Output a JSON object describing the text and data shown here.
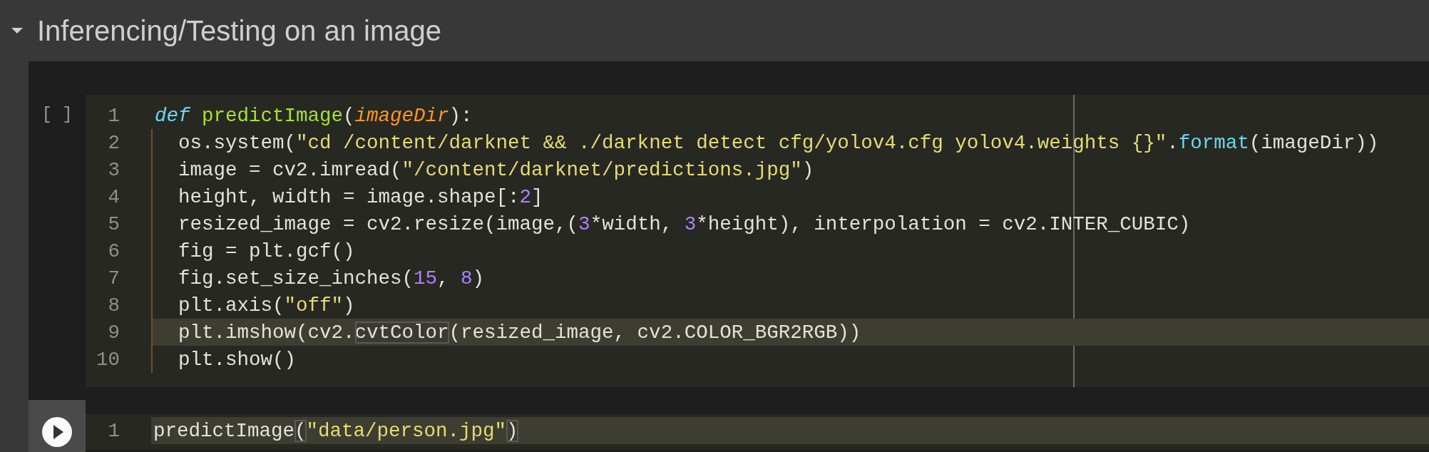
{
  "section": {
    "title": "Inferencing/Testing on an image",
    "expanded": true
  },
  "cells": [
    {
      "kind": "code",
      "execution_label": "[ ]",
      "lines": [
        {
          "number": "1",
          "active": false,
          "tokens": [
            {
              "kind": "keyword",
              "text": "def"
            },
            {
              "kind": "defname",
              "text": " predictImage"
            },
            {
              "kind": "plain",
              "text": "("
            },
            {
              "kind": "param",
              "text": "imageDir"
            },
            {
              "kind": "plain",
              "text": "):"
            }
          ]
        },
        {
          "number": "2",
          "active": false,
          "tokens": [
            {
              "kind": "plain",
              "text": "  os.system("
            },
            {
              "kind": "string",
              "text": "\"cd /content/darknet && ./darknet detect cfg/yolov4.cfg yolov4.weights {}\""
            },
            {
              "kind": "plain",
              "text": "."
            },
            {
              "kind": "builtin",
              "text": "format"
            },
            {
              "kind": "plain",
              "text": "(imageDir))"
            }
          ]
        },
        {
          "number": "3",
          "active": false,
          "tokens": [
            {
              "kind": "plain",
              "text": "  image = cv2.imread("
            },
            {
              "kind": "string",
              "text": "\"/content/darknet/predictions.jpg\""
            },
            {
              "kind": "plain",
              "text": ")"
            }
          ]
        },
        {
          "number": "4",
          "active": false,
          "tokens": [
            {
              "kind": "plain",
              "text": "  height, width = image.shape[:"
            },
            {
              "kind": "number",
              "text": "2"
            },
            {
              "kind": "plain",
              "text": "]"
            }
          ]
        },
        {
          "number": "5",
          "active": false,
          "tokens": [
            {
              "kind": "plain",
              "text": "  resized_image = cv2.resize(image,("
            },
            {
              "kind": "number",
              "text": "3"
            },
            {
              "kind": "plain",
              "text": "*width, "
            },
            {
              "kind": "number",
              "text": "3"
            },
            {
              "kind": "plain",
              "text": "*height), interpolation = cv2.INTER_CUBIC)"
            }
          ]
        },
        {
          "number": "6",
          "active": false,
          "tokens": [
            {
              "kind": "plain",
              "text": "  fig = plt.gcf()"
            }
          ]
        },
        {
          "number": "7",
          "active": false,
          "tokens": [
            {
              "kind": "plain",
              "text": "  fig.set_size_inches("
            },
            {
              "kind": "number",
              "text": "15"
            },
            {
              "kind": "plain",
              "text": ", "
            },
            {
              "kind": "number",
              "text": "8"
            },
            {
              "kind": "plain",
              "text": ")"
            }
          ]
        },
        {
          "number": "8",
          "active": false,
          "tokens": [
            {
              "kind": "plain",
              "text": "  plt.axis("
            },
            {
              "kind": "string",
              "text": "\"off\""
            },
            {
              "kind": "plain",
              "text": ")"
            }
          ]
        },
        {
          "number": "9",
          "active": true,
          "tokens": [
            {
              "kind": "plain",
              "text": "  plt.imshow(cv2."
            },
            {
              "kind": "match",
              "text": "cvtColor"
            },
            {
              "kind": "plain",
              "text": "(resized_image, cv2.COLOR_BGR2RGB))"
            }
          ]
        },
        {
          "number": "10",
          "active": false,
          "tokens": [
            {
              "kind": "plain",
              "text": "  plt.show()"
            }
          ]
        }
      ]
    },
    {
      "kind": "run",
      "lines": [
        {
          "number": "1",
          "active": true,
          "tokens": [
            {
              "kind": "plain",
              "text": "predictImage"
            },
            {
              "kind": "match",
              "text": "("
            },
            {
              "kind": "string",
              "text": "\"data/person.jpg\""
            },
            {
              "kind": "match",
              "text": ")"
            }
          ]
        }
      ]
    }
  ]
}
